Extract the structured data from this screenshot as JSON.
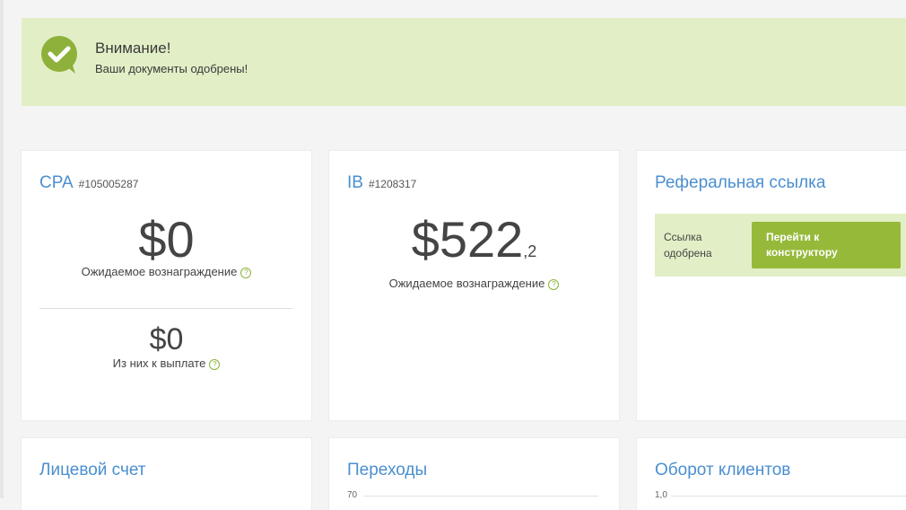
{
  "alert": {
    "title": "Внимание!",
    "text": "Ваши документы одобрены!"
  },
  "cpa": {
    "label": "CPA",
    "number": "#105005287",
    "expected_amount": "$0",
    "expected_label": "Ожидаемое вознаграждение",
    "payout_amount": "$0",
    "payout_label": "Из них к выплате"
  },
  "ib": {
    "label": "IB",
    "number": "#1208317",
    "expected_amount_main": "$522",
    "expected_amount_fraction": ",2",
    "expected_label": "Ожидаемое вознаграждение"
  },
  "referral": {
    "title": "Реферальная ссылка",
    "status": "Ссылка одобрена",
    "button_label": "Перейти к конструктору"
  },
  "cards_bottom": {
    "account_title": "Лицевой счет",
    "clicks_title": "Переходы",
    "clicks_axis_top": "70",
    "turnover_title": "Оборот клиентов",
    "turnover_axis_top": "1,0"
  },
  "help_glyph": "?",
  "colors": {
    "accent_blue": "#4a8fd0",
    "alert_bg": "#e2efc6",
    "success_green": "#8db13a"
  }
}
